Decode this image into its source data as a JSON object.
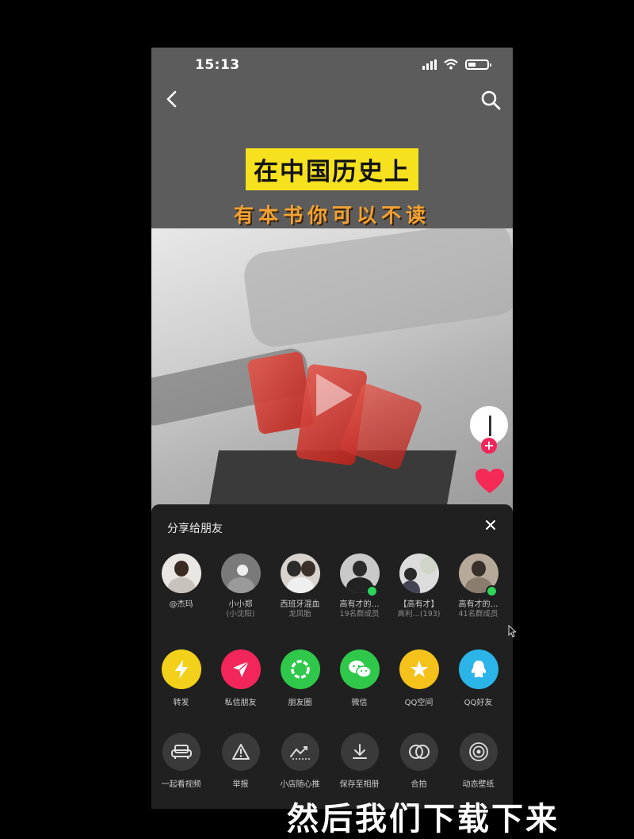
{
  "status": {
    "time": "15:13"
  },
  "video": {
    "title_main": "在中国历史上",
    "title_sub": "有本书你可以不读"
  },
  "share_sheet": {
    "title": "分享给朋友",
    "friends": [
      {
        "name": "@杰玛",
        "sub": "",
        "online": false
      },
      {
        "name": "小小郑",
        "sub": "(小沈阳)",
        "online": false
      },
      {
        "name": "西班牙混血",
        "sub": "龙凤胎",
        "online": false
      },
      {
        "name": "高有才的…",
        "sub": "19名群成员",
        "online": true
      },
      {
        "name": "【高有才】",
        "sub": "高利…(193)",
        "online": false
      },
      {
        "name": "高有才的…",
        "sub": "41名群成员",
        "online": true
      }
    ],
    "share_targets": [
      {
        "label": "转发",
        "icon": "lightning-icon",
        "color": "#f3d11a"
      },
      {
        "label": "私信朋友",
        "icon": "send-icon",
        "color": "#f2265a"
      },
      {
        "label": "朋友圈",
        "icon": "moments-icon",
        "color": "#2fc84a"
      },
      {
        "label": "微信",
        "icon": "wechat-icon",
        "color": "#2fc84a"
      },
      {
        "label": "QQ空间",
        "icon": "qzone-icon",
        "color": "#f4c21a"
      },
      {
        "label": "QQ好友",
        "icon": "qq-icon",
        "color": "#2ab4e8"
      }
    ],
    "actions": [
      {
        "label": "一起看视频",
        "icon": "sofa-icon"
      },
      {
        "label": "举报",
        "icon": "warning-icon"
      },
      {
        "label": "小店随心推",
        "icon": "boost-icon"
      },
      {
        "label": "保存至相册",
        "icon": "download-icon"
      },
      {
        "label": "合拍",
        "icon": "duet-icon"
      },
      {
        "label": "动态壁纸",
        "icon": "wallpaper-icon"
      }
    ]
  },
  "caption": "然后我们下载下来"
}
